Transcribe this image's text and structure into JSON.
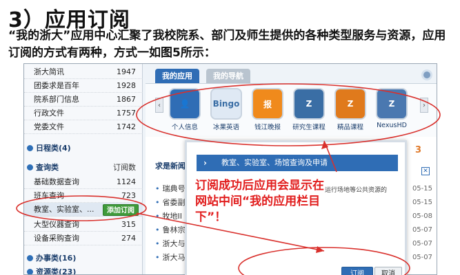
{
  "slide": {
    "heading": "3）应用订阅",
    "intro": "“我的浙大”应用中心汇聚了我校院系、部门及师生提供的各种类型服务与资源，应用订阅的方式有两种，方式一如图5所示："
  },
  "sidebar": {
    "rows": [
      {
        "name": "浙大简讯",
        "count": "1947"
      },
      {
        "name": "团委求是百年",
        "count": "1928"
      },
      {
        "name": "院系部门信息",
        "count": "1867"
      },
      {
        "name": "行政文件",
        "count": "1757"
      },
      {
        "name": "党委文件",
        "count": "1742"
      }
    ],
    "schedule": "日程类(4)",
    "query": {
      "label": "查询类",
      "sub": "订阅数"
    },
    "query_rows": [
      {
        "name": "基础数据查询",
        "count": "1124"
      },
      {
        "name": "班车查询",
        "count": "723"
      },
      {
        "name": "教室、实验室、...",
        "count": "",
        "action": "添加订阅"
      },
      {
        "name": "大型仪器查询",
        "count": "315"
      },
      {
        "name": "设备采购查询",
        "count": "274"
      }
    ],
    "office": "办事类(16)",
    "resource": "资源类(23)"
  },
  "main": {
    "tabs": [
      "我的应用",
      "我的导航"
    ],
    "apps": [
      {
        "label": "个人信息",
        "color": "#2f6db5",
        "glyph": "👤"
      },
      {
        "label": "冰果英语",
        "color": "#e8f0f8",
        "glyph": "Bingo"
      },
      {
        "label": "钱江晚报",
        "color": "#f08a1c",
        "glyph": "报"
      },
      {
        "label": "研究生课程",
        "color": "#3a6ea5",
        "glyph": "Z"
      },
      {
        "label": "精品课程",
        "color": "#e07a1c",
        "glyph": "Z"
      },
      {
        "label": "NexusHD",
        "color": "#4a78b0",
        "glyph": "Z"
      }
    ],
    "news_title": "求是新闻",
    "news_rows": [
      {
        "text": "瑞典号",
        "date": "05-15"
      },
      {
        "text": "省委副",
        "date": "05-15"
      },
      {
        "text": "牧地II",
        "date": "05-08"
      },
      {
        "text": "鲁林宗",
        "date": "05-07"
      },
      {
        "text": "浙大与",
        "date": "05-07"
      },
      {
        "text": "浙大马",
        "date": "05-07"
      }
    ],
    "corner_num": "3"
  },
  "modal": {
    "banner": "教室、实验室、场馆查询及申请",
    "annotation": "订阅成功后应用会显示在网站中间“我的应用栏目下”！",
    "desc": "运行场地等公共资源的",
    "ok": "订阅",
    "cancel": "取消"
  },
  "colors": {
    "annotation": "#e11d1d",
    "accent": "#2f6db5"
  }
}
